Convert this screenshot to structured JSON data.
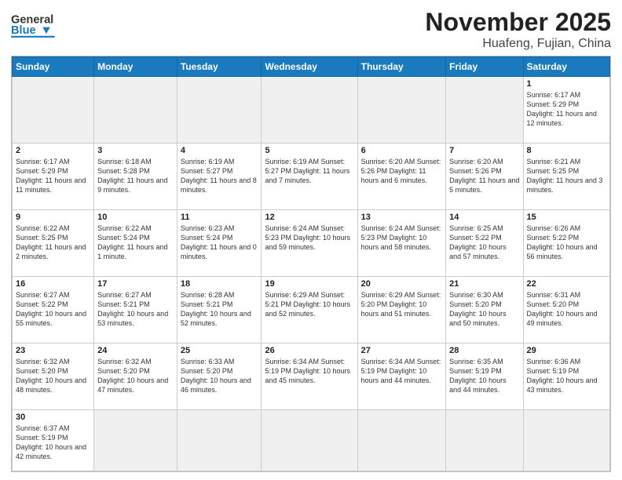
{
  "header": {
    "logo_general": "General",
    "logo_blue": "Blue",
    "title": "November 2025",
    "subtitle": "Huafeng, Fujian, China"
  },
  "days": [
    "Sunday",
    "Monday",
    "Tuesday",
    "Wednesday",
    "Thursday",
    "Friday",
    "Saturday"
  ],
  "weeks": [
    [
      {
        "num": "",
        "info": ""
      },
      {
        "num": "",
        "info": ""
      },
      {
        "num": "",
        "info": ""
      },
      {
        "num": "",
        "info": ""
      },
      {
        "num": "",
        "info": ""
      },
      {
        "num": "",
        "info": ""
      },
      {
        "num": "1",
        "info": "Sunrise: 6:17 AM\nSunset: 5:29 PM\nDaylight: 11 hours\nand 12 minutes."
      }
    ],
    [
      {
        "num": "2",
        "info": "Sunrise: 6:17 AM\nSunset: 5:29 PM\nDaylight: 11 hours\nand 11 minutes."
      },
      {
        "num": "3",
        "info": "Sunrise: 6:18 AM\nSunset: 5:28 PM\nDaylight: 11 hours\nand 9 minutes."
      },
      {
        "num": "4",
        "info": "Sunrise: 6:19 AM\nSunset: 5:27 PM\nDaylight: 11 hours\nand 8 minutes."
      },
      {
        "num": "5",
        "info": "Sunrise: 6:19 AM\nSunset: 5:27 PM\nDaylight: 11 hours\nand 7 minutes."
      },
      {
        "num": "6",
        "info": "Sunrise: 6:20 AM\nSunset: 5:26 PM\nDaylight: 11 hours\nand 6 minutes."
      },
      {
        "num": "7",
        "info": "Sunrise: 6:20 AM\nSunset: 5:26 PM\nDaylight: 11 hours\nand 5 minutes."
      },
      {
        "num": "8",
        "info": "Sunrise: 6:21 AM\nSunset: 5:25 PM\nDaylight: 11 hours\nand 3 minutes."
      }
    ],
    [
      {
        "num": "9",
        "info": "Sunrise: 6:22 AM\nSunset: 5:25 PM\nDaylight: 11 hours\nand 2 minutes."
      },
      {
        "num": "10",
        "info": "Sunrise: 6:22 AM\nSunset: 5:24 PM\nDaylight: 11 hours\nand 1 minute."
      },
      {
        "num": "11",
        "info": "Sunrise: 6:23 AM\nSunset: 5:24 PM\nDaylight: 11 hours\nand 0 minutes."
      },
      {
        "num": "12",
        "info": "Sunrise: 6:24 AM\nSunset: 5:23 PM\nDaylight: 10 hours\nand 59 minutes."
      },
      {
        "num": "13",
        "info": "Sunrise: 6:24 AM\nSunset: 5:23 PM\nDaylight: 10 hours\nand 58 minutes."
      },
      {
        "num": "14",
        "info": "Sunrise: 6:25 AM\nSunset: 5:22 PM\nDaylight: 10 hours\nand 57 minutes."
      },
      {
        "num": "15",
        "info": "Sunrise: 6:26 AM\nSunset: 5:22 PM\nDaylight: 10 hours\nand 56 minutes."
      }
    ],
    [
      {
        "num": "16",
        "info": "Sunrise: 6:27 AM\nSunset: 5:22 PM\nDaylight: 10 hours\nand 55 minutes."
      },
      {
        "num": "17",
        "info": "Sunrise: 6:27 AM\nSunset: 5:21 PM\nDaylight: 10 hours\nand 53 minutes."
      },
      {
        "num": "18",
        "info": "Sunrise: 6:28 AM\nSunset: 5:21 PM\nDaylight: 10 hours\nand 52 minutes."
      },
      {
        "num": "19",
        "info": "Sunrise: 6:29 AM\nSunset: 5:21 PM\nDaylight: 10 hours\nand 52 minutes."
      },
      {
        "num": "20",
        "info": "Sunrise: 6:29 AM\nSunset: 5:20 PM\nDaylight: 10 hours\nand 51 minutes."
      },
      {
        "num": "21",
        "info": "Sunrise: 6:30 AM\nSunset: 5:20 PM\nDaylight: 10 hours\nand 50 minutes."
      },
      {
        "num": "22",
        "info": "Sunrise: 6:31 AM\nSunset: 5:20 PM\nDaylight: 10 hours\nand 49 minutes."
      }
    ],
    [
      {
        "num": "23",
        "info": "Sunrise: 6:32 AM\nSunset: 5:20 PM\nDaylight: 10 hours\nand 48 minutes."
      },
      {
        "num": "24",
        "info": "Sunrise: 6:32 AM\nSunset: 5:20 PM\nDaylight: 10 hours\nand 47 minutes."
      },
      {
        "num": "25",
        "info": "Sunrise: 6:33 AM\nSunset: 5:20 PM\nDaylight: 10 hours\nand 46 minutes."
      },
      {
        "num": "26",
        "info": "Sunrise: 6:34 AM\nSunset: 5:19 PM\nDaylight: 10 hours\nand 45 minutes."
      },
      {
        "num": "27",
        "info": "Sunrise: 6:34 AM\nSunset: 5:19 PM\nDaylight: 10 hours\nand 44 minutes."
      },
      {
        "num": "28",
        "info": "Sunrise: 6:35 AM\nSunset: 5:19 PM\nDaylight: 10 hours\nand 44 minutes."
      },
      {
        "num": "29",
        "info": "Sunrise: 6:36 AM\nSunset: 5:19 PM\nDaylight: 10 hours\nand 43 minutes."
      }
    ],
    [
      {
        "num": "30",
        "info": "Sunrise: 6:37 AM\nSunset: 5:19 PM\nDaylight: 10 hours\nand 42 minutes."
      },
      {
        "num": "",
        "info": ""
      },
      {
        "num": "",
        "info": ""
      },
      {
        "num": "",
        "info": ""
      },
      {
        "num": "",
        "info": ""
      },
      {
        "num": "",
        "info": ""
      },
      {
        "num": "",
        "info": ""
      }
    ]
  ]
}
